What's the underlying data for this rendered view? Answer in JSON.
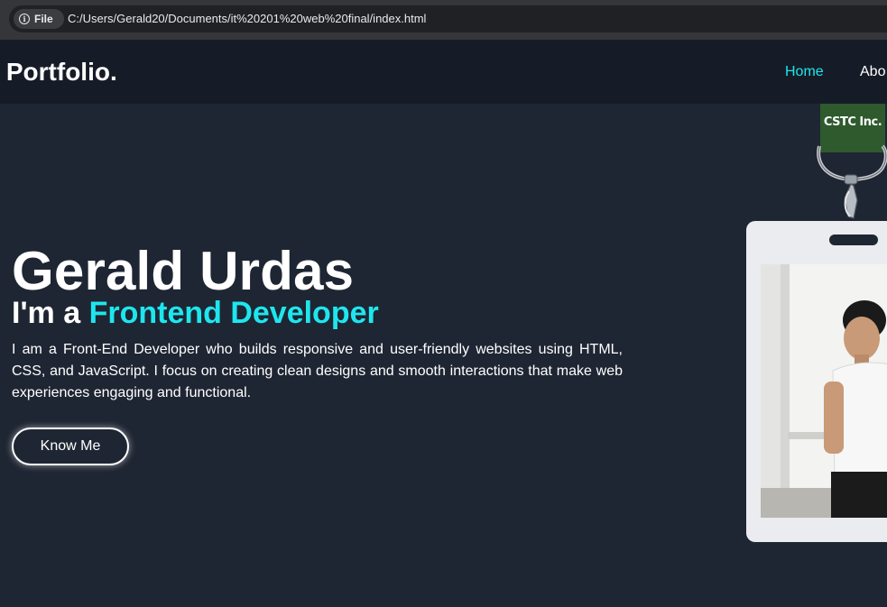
{
  "browser": {
    "file_chip": "File",
    "url": "C:/Users/Gerald20/Documents/it%20201%20web%20final/index.html"
  },
  "header": {
    "logo": "o Portfolio.",
    "nav": [
      "Home",
      "Abo"
    ]
  },
  "hero": {
    "name": "Gerald Urdas",
    "role_prefix": "I'm a ",
    "role_highlight": "Frontend Developer",
    "description": "I am a Front-End Developer who builds responsive and user-friendly websites using HTML, CSS, and JavaScript. I focus on creating clean designs and smooth interactions that make web experiences engaging and functional.",
    "cta": "Know Me"
  },
  "badge": {
    "lanyard_text": "CSTC Inc."
  },
  "colors": {
    "background": "#1f2633",
    "header": "#161c27",
    "accent": "#1ee6ee",
    "lanyard": "#2e5a2e"
  }
}
